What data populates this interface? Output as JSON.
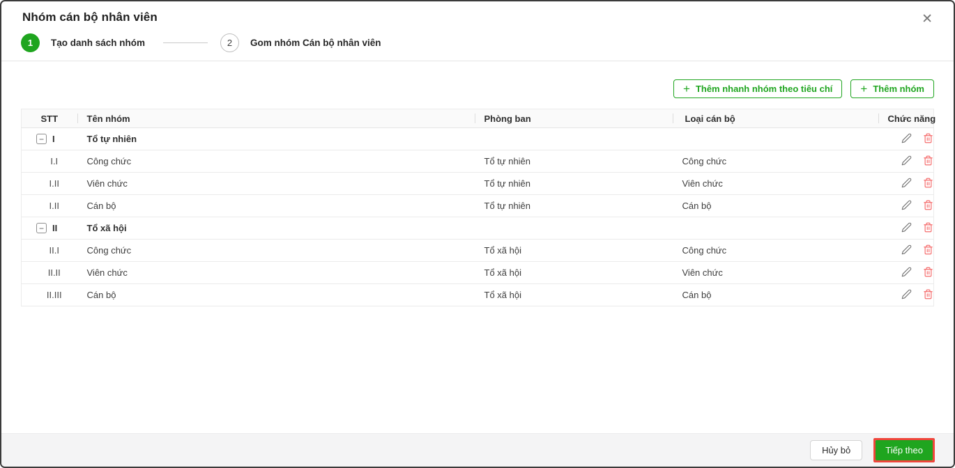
{
  "modal": {
    "title": "Nhóm cán bộ nhân viên"
  },
  "icons": {
    "close": "✕",
    "plus": "+",
    "collapse_minus": "−"
  },
  "stepper": {
    "steps": [
      {
        "number": "1",
        "label": "Tạo danh sách nhóm",
        "state": "active"
      },
      {
        "number": "2",
        "label": "Gom nhóm Cán bộ nhân viên",
        "state": "inactive"
      }
    ]
  },
  "toolbar": {
    "quick_add_label": "Thêm nhanh nhóm theo tiêu chí",
    "add_label": "Thêm nhóm"
  },
  "table": {
    "headers": [
      "STT",
      "Tên nhóm",
      "Phòng ban",
      "Loại cán bộ",
      "Chức năng"
    ],
    "rows": [
      {
        "stt": "I",
        "name": "Tổ tự nhiên",
        "department": "",
        "staff_type": "",
        "group": true
      },
      {
        "stt": "I.I",
        "name": "Công chức",
        "department": "Tổ tự nhiên",
        "staff_type": "Công chức",
        "group": false
      },
      {
        "stt": "I.II",
        "name": "Viên chức",
        "department": "Tổ tự nhiên",
        "staff_type": "Viên chức",
        "group": false
      },
      {
        "stt": "I.II",
        "name": "Cán bộ",
        "department": "Tổ tự nhiên",
        "staff_type": "Cán bộ",
        "group": false
      },
      {
        "stt": "II",
        "name": "Tổ xã hội",
        "department": "",
        "staff_type": "",
        "group": true
      },
      {
        "stt": "II.I",
        "name": "Công chức",
        "department": "Tổ xã hội",
        "staff_type": "Công chức",
        "group": false
      },
      {
        "stt": "II.II",
        "name": "Viên chức",
        "department": "Tổ xã hội",
        "staff_type": "Viên chức",
        "group": false
      },
      {
        "stt": "II.III",
        "name": "Cán bộ",
        "department": "Tổ xã hội",
        "staff_type": "Cán bộ",
        "group": false
      }
    ]
  },
  "footer": {
    "cancel_label": "Hủy bỏ",
    "next_label": "Tiếp theo"
  },
  "colors": {
    "primary_green": "#1FA51F",
    "danger_red": "#F56C6C",
    "annotation_red": "#EF453B"
  }
}
